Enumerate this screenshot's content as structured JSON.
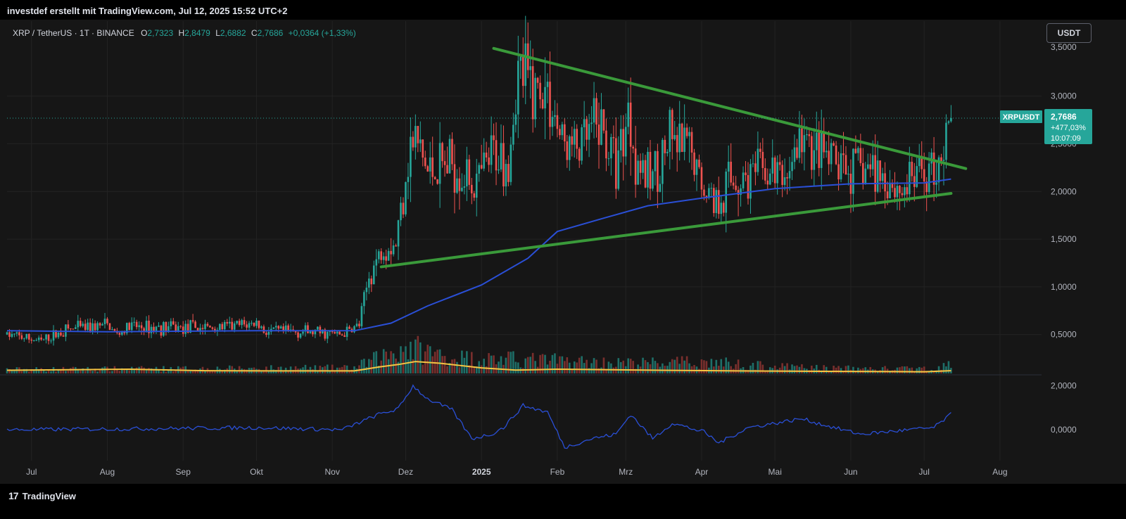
{
  "caption": "investdef erstellt mit TradingView.com, Jul 12, 2025 15:52 UTC+2",
  "legend": {
    "symbol": "XRP / TetherUS · 1T · BINANCE",
    "o_key": "O",
    "o_val": "2,7323",
    "h_key": "H",
    "h_val": "2,8479",
    "l_key": "L",
    "l_val": "2,6882",
    "c_key": "C",
    "c_val": "2,7686",
    "change": "+0,0364 (+1,33%)"
  },
  "currency_label": "USDT",
  "price_tag": {
    "symbol": "XRPUSDT",
    "price": "2,7686",
    "change": "+477,03%",
    "countdown": "10:07:09"
  },
  "brand": {
    "logo": "17",
    "name": "TradingView"
  },
  "colors": {
    "up": "#26a69a",
    "down": "#ef5350",
    "trendline": "#3a9a3a",
    "ma": "#2a4fd6",
    "volume_ma": "#f5c542",
    "oscillator": "#2a4fd6",
    "tag_bg": "#26a69a",
    "background": "#161616"
  },
  "chart_data": {
    "type": "candlestick",
    "x_range": [
      "2024-06-21",
      "2025-08-18"
    ],
    "price_axis": {
      "ylim": [
        0.1,
        3.55
      ],
      "ticks": [
        3.0,
        2.5,
        2.0,
        1.5,
        1.0,
        0.5
      ],
      "tick_labels": [
        "3,0000",
        "2,5000",
        "2,0000",
        "1,5000",
        "1,0000",
        "0,5000"
      ],
      "clipped_top_label": "3,5000"
    },
    "oscillator_axis": {
      "ylim": [
        -1.4,
        2.4
      ],
      "ticks": [
        2.0,
        0.0
      ],
      "tick_labels": [
        "2,0000",
        "0,0000"
      ]
    },
    "x_ticks": [
      {
        "date": "2024-07-01",
        "label": "Jul",
        "bold": false
      },
      {
        "date": "2024-08-01",
        "label": "Aug",
        "bold": false
      },
      {
        "date": "2024-09-01",
        "label": "Sep",
        "bold": false
      },
      {
        "date": "2024-10-01",
        "label": "Okt",
        "bold": false
      },
      {
        "date": "2024-11-01",
        "label": "Nov",
        "bold": false
      },
      {
        "date": "2024-12-01",
        "label": "Dez",
        "bold": false
      },
      {
        "date": "2025-01-01",
        "label": "2025",
        "bold": true
      },
      {
        "date": "2025-02-01",
        "label": "Feb",
        "bold": false
      },
      {
        "date": "2025-03-01",
        "label": "Mrz",
        "bold": false
      },
      {
        "date": "2025-04-01",
        "label": "Apr",
        "bold": false
      },
      {
        "date": "2025-05-01",
        "label": "Mai",
        "bold": false
      },
      {
        "date": "2025-06-01",
        "label": "Jun",
        "bold": false
      },
      {
        "date": "2025-07-01",
        "label": "Jul",
        "bold": false
      },
      {
        "date": "2025-08-01",
        "label": "Aug",
        "bold": false
      }
    ],
    "price_path": [
      [
        "2024-06-21",
        0.5
      ],
      [
        "2024-07-05",
        0.43
      ],
      [
        "2024-07-15",
        0.55
      ],
      [
        "2024-08-01",
        0.6
      ],
      [
        "2024-08-05",
        0.5
      ],
      [
        "2024-08-10",
        0.58
      ],
      [
        "2024-09-01",
        0.57
      ],
      [
        "2024-09-20",
        0.58
      ],
      [
        "2024-10-01",
        0.62
      ],
      [
        "2024-10-05",
        0.53
      ],
      [
        "2024-10-20",
        0.53
      ],
      [
        "2024-11-05",
        0.5
      ],
      [
        "2024-11-12",
        0.6
      ],
      [
        "2024-11-16",
        1.1
      ],
      [
        "2024-11-22",
        1.45
      ],
      [
        "2024-11-27",
        1.45
      ],
      [
        "2024-12-02",
        2.4
      ],
      [
        "2024-12-05",
        2.55
      ],
      [
        "2024-12-10",
        2.2
      ],
      [
        "2024-12-20",
        2.3
      ],
      [
        "2024-12-30",
        2.05
      ],
      [
        "2025-01-06",
        2.4
      ],
      [
        "2025-01-12",
        2.35
      ],
      [
        "2025-01-16",
        3.25
      ],
      [
        "2025-01-22",
        3.1
      ],
      [
        "2025-01-28",
        3.05
      ],
      [
        "2025-02-03",
        2.5
      ],
      [
        "2025-02-10",
        2.45
      ],
      [
        "2025-02-18",
        2.7
      ],
      [
        "2025-02-25",
        2.3
      ],
      [
        "2025-03-02",
        2.85
      ],
      [
        "2025-03-05",
        2.4
      ],
      [
        "2025-03-10",
        2.1
      ],
      [
        "2025-03-19",
        2.5
      ],
      [
        "2025-03-27",
        2.4
      ],
      [
        "2025-04-01",
        2.1
      ],
      [
        "2025-04-07",
        1.9
      ],
      [
        "2025-04-12",
        2.1
      ],
      [
        "2025-04-25",
        2.2
      ],
      [
        "2025-05-05",
        2.15
      ],
      [
        "2025-05-12",
        2.55
      ],
      [
        "2025-05-20",
        2.35
      ],
      [
        "2025-06-01",
        2.2
      ],
      [
        "2025-06-10",
        2.25
      ],
      [
        "2025-06-22",
        2.0
      ],
      [
        "2025-06-28",
        2.2
      ],
      [
        "2025-07-05",
        2.25
      ],
      [
        "2025-07-10",
        2.5
      ],
      [
        "2025-07-12",
        2.7686
      ]
    ],
    "moving_average": [
      [
        "2024-06-21",
        0.54
      ],
      [
        "2024-08-01",
        0.53
      ],
      [
        "2024-10-01",
        0.54
      ],
      [
        "2024-11-10",
        0.54
      ],
      [
        "2024-11-25",
        0.62
      ],
      [
        "2024-12-10",
        0.8
      ],
      [
        "2025-01-01",
        1.02
      ],
      [
        "2025-01-20",
        1.3
      ],
      [
        "2025-02-01",
        1.58
      ],
      [
        "2025-02-20",
        1.72
      ],
      [
        "2025-03-10",
        1.85
      ],
      [
        "2025-04-01",
        1.93
      ],
      [
        "2025-05-01",
        2.03
      ],
      [
        "2025-06-01",
        2.08
      ],
      [
        "2025-07-01",
        2.09
      ],
      [
        "2025-07-12",
        2.13
      ]
    ],
    "trendlines": [
      {
        "name": "upper",
        "from": [
          "2025-01-06",
          3.5
        ],
        "to": [
          "2025-07-18",
          2.24
        ]
      },
      {
        "name": "lower",
        "from": [
          "2024-11-21",
          1.21
        ],
        "to": [
          "2025-07-12",
          1.98
        ]
      }
    ],
    "volume": {
      "ylim": [
        0,
        4
      ],
      "values_path": [
        [
          "2024-06-21",
          0.18
        ],
        [
          "2024-11-10",
          0.25
        ],
        [
          "2024-12-01",
          1.2
        ],
        [
          "2024-12-20",
          0.7
        ],
        [
          "2025-01-20",
          0.6
        ],
        [
          "2025-02-05",
          0.55
        ],
        [
          "2025-03-01",
          0.45
        ],
        [
          "2025-04-05",
          0.5
        ],
        [
          "2025-05-01",
          0.3
        ],
        [
          "2025-06-01",
          0.22
        ],
        [
          "2025-07-05",
          0.2
        ],
        [
          "2025-07-12",
          0.4
        ]
      ],
      "volume_ma": [
        [
          "2024-06-21",
          0.15
        ],
        [
          "2024-07-20",
          0.18
        ],
        [
          "2024-08-10",
          0.2
        ],
        [
          "2024-09-10",
          0.13
        ],
        [
          "2024-10-10",
          0.12
        ],
        [
          "2024-11-10",
          0.12
        ],
        [
          "2024-11-20",
          0.3
        ],
        [
          "2024-11-28",
          0.42
        ],
        [
          "2024-12-05",
          0.56
        ],
        [
          "2024-12-15",
          0.48
        ],
        [
          "2025-01-01",
          0.26
        ],
        [
          "2025-01-15",
          0.16
        ],
        [
          "2025-02-01",
          0.2
        ],
        [
          "2025-02-20",
          0.18
        ],
        [
          "2025-03-15",
          0.15
        ],
        [
          "2025-04-15",
          0.12
        ],
        [
          "2025-05-20",
          0.1
        ],
        [
          "2025-07-01",
          0.08
        ],
        [
          "2025-07-12",
          0.13
        ]
      ]
    },
    "oscillator": [
      [
        "2024-06-21",
        0.0
      ],
      [
        "2024-08-15",
        0.05
      ],
      [
        "2024-10-01",
        0.1
      ],
      [
        "2024-11-05",
        0.0
      ],
      [
        "2024-11-20",
        0.7
      ],
      [
        "2024-11-28",
        0.95
      ],
      [
        "2024-12-04",
        2.0
      ],
      [
        "2024-12-10",
        1.4
      ],
      [
        "2024-12-20",
        0.9
      ],
      [
        "2024-12-28",
        -0.4
      ],
      [
        "2025-01-05",
        -0.2
      ],
      [
        "2025-01-10",
        0.1
      ],
      [
        "2025-01-18",
        1.1
      ],
      [
        "2025-01-28",
        0.8
      ],
      [
        "2025-02-04",
        -0.8
      ],
      [
        "2025-02-15",
        -0.4
      ],
      [
        "2025-02-25",
        -0.2
      ],
      [
        "2025-03-03",
        0.7
      ],
      [
        "2025-03-12",
        -0.4
      ],
      [
        "2025-03-20",
        0.3
      ],
      [
        "2025-04-02",
        -0.1
      ],
      [
        "2025-04-08",
        -0.6
      ],
      [
        "2025-04-20",
        0.1
      ],
      [
        "2025-05-12",
        0.5
      ],
      [
        "2025-05-25",
        0.1
      ],
      [
        "2025-06-05",
        -0.2
      ],
      [
        "2025-06-25",
        0.0
      ],
      [
        "2025-07-05",
        0.1
      ],
      [
        "2025-07-12",
        0.7
      ]
    ],
    "last_price": 2.7686
  }
}
